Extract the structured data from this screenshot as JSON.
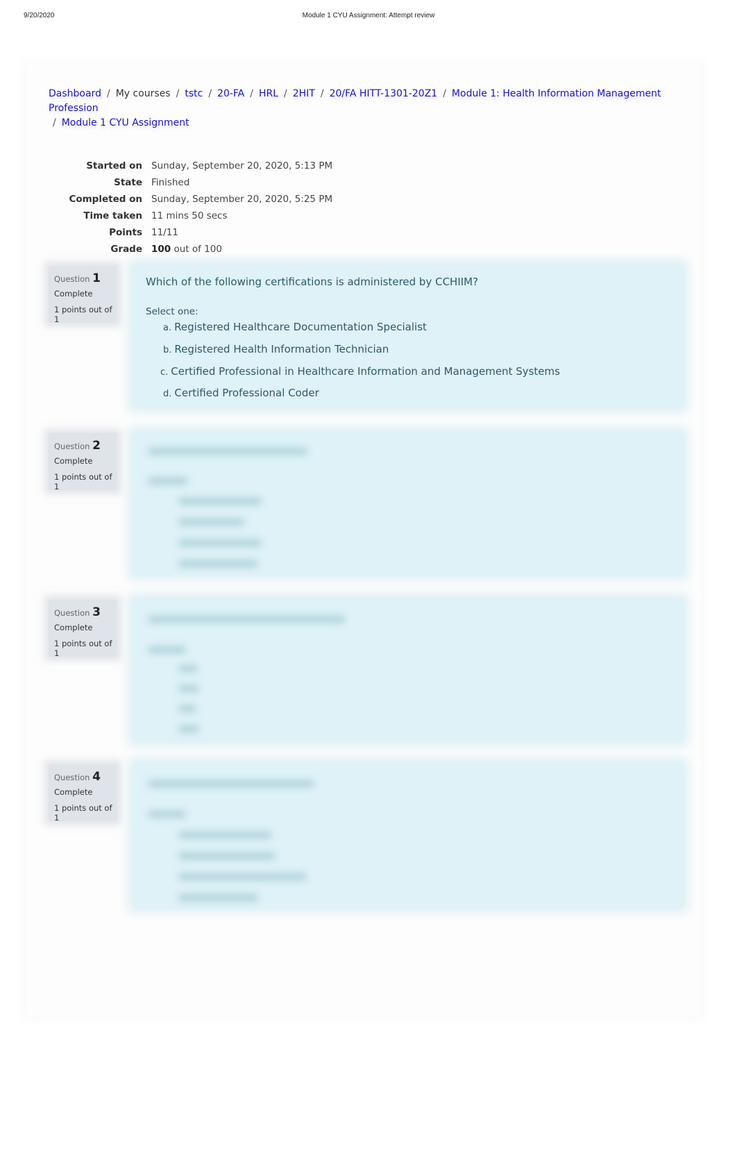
{
  "print_header": {
    "date": "9/20/2020",
    "title": "Module 1 CYU Assignment: Attempt review"
  },
  "breadcrumb": [
    {
      "label": "Dashboard",
      "link": true
    },
    {
      "label": "My courses",
      "link": false
    },
    {
      "label": "tstc",
      "link": true
    },
    {
      "label": "20-FA",
      "link": true
    },
    {
      "label": "HRL",
      "link": true
    },
    {
      "label": "2HIT",
      "link": true
    },
    {
      "label": "20/FA HITT-1301-20Z1",
      "link": true
    },
    {
      "label": "Module 1: Health Information Management Profession",
      "link": true
    },
    {
      "label": "Module 1 CYU Assignment",
      "link": true
    }
  ],
  "breadcrumb_separator": "/",
  "summary": {
    "started_on": {
      "label": "Started on",
      "value": "Sunday, September 20, 2020, 5:13 PM"
    },
    "state": {
      "label": "State",
      "value": "Finished"
    },
    "completed_on": {
      "label": "Completed on",
      "value": "Sunday, September 20, 2020, 5:25 PM"
    },
    "time_taken": {
      "label": "Time taken",
      "value": "11 mins 50 secs"
    },
    "points": {
      "label": "Points",
      "value": "11/11"
    },
    "grade": {
      "label": "Grade",
      "score": "100",
      "suffix": "out of 100"
    }
  },
  "questions": [
    {
      "label": "Question",
      "number": "1",
      "state": "Complete",
      "grade": "1 points out of 1",
      "text": "Which of the following certifications is administered by CCHIIM?",
      "prompt": "Select one:",
      "answers": [
        {
          "letter": "a.",
          "text": "Registered Healthcare Documentation Specialist"
        },
        {
          "letter": "b.",
          "text": "Registered Health Information Technician"
        },
        {
          "letter": "c.",
          "text": "Certified Professional in Healthcare Information and Management Systems"
        },
        {
          "letter": "d.",
          "text": "Certified Professional Coder"
        }
      ]
    },
    {
      "label": "Question",
      "number": "2",
      "state": "Complete",
      "grade": "1 points out of 1",
      "blurred": true
    },
    {
      "label": "Question",
      "number": "3",
      "state": "Complete",
      "grade": "1 points out of 1",
      "blurred": true
    },
    {
      "label": "Question",
      "number": "4",
      "state": "Complete",
      "grade": "1 points out of 1",
      "blurred": true
    }
  ],
  "colors": {
    "link": "#1a14c8",
    "question_bg": "#def2f7",
    "info_bg": "#dfe3ea",
    "question_text": "#2f5a6a"
  }
}
